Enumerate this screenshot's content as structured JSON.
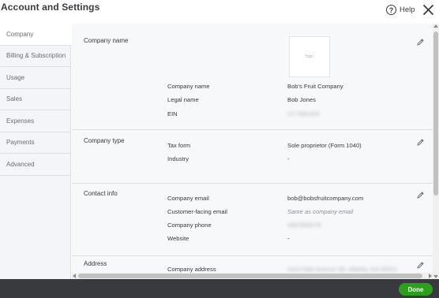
{
  "header": {
    "title": "Account and Settings",
    "help_label": "Help",
    "help_glyph": "?"
  },
  "sidebar": {
    "items": [
      {
        "label": "Company",
        "active": true
      },
      {
        "label": "Billing & Subscription",
        "active": false
      },
      {
        "label": "Usage",
        "active": false
      },
      {
        "label": "Sales",
        "active": false
      },
      {
        "label": "Expenses",
        "active": false
      },
      {
        "label": "Payments",
        "active": false
      },
      {
        "label": "Advanced",
        "active": false
      }
    ]
  },
  "company_name_section": {
    "title": "Company name",
    "logo_placeholder": "logo",
    "rows": [
      {
        "label": "Company name",
        "value": "Bob's Fruit Company"
      },
      {
        "label": "Legal name",
        "value": "Bob Jones"
      },
      {
        "label": "EIN",
        "value": "12-7581424"
      }
    ]
  },
  "company_type_section": {
    "title": "Company type",
    "rows": [
      {
        "label": "Tax form",
        "value": "Sole proprietor (Form 1040)"
      },
      {
        "label": "Industry",
        "value": "-"
      }
    ]
  },
  "contact_info_section": {
    "title": "Contact info",
    "rows": [
      {
        "label": "Company email",
        "value": "bob@bobsfruitcompany.com"
      },
      {
        "label": "Customer-facing email",
        "value": "Same as company email"
      },
      {
        "label": "Company phone",
        "value": "4567845279"
      },
      {
        "label": "Website",
        "value": "-"
      }
    ]
  },
  "address_section": {
    "title": "Address",
    "rows": [
      {
        "label": "Company address",
        "value": "4110 Park Avenue SE, Atlanta, GA 30312"
      }
    ]
  },
  "footer": {
    "done_label": "Done"
  },
  "colors": {
    "accent_green": "#2ca01c",
    "footer_bg": "#393a3d",
    "sidebar_bg": "#f4f5f8",
    "text": "#393a3d"
  }
}
